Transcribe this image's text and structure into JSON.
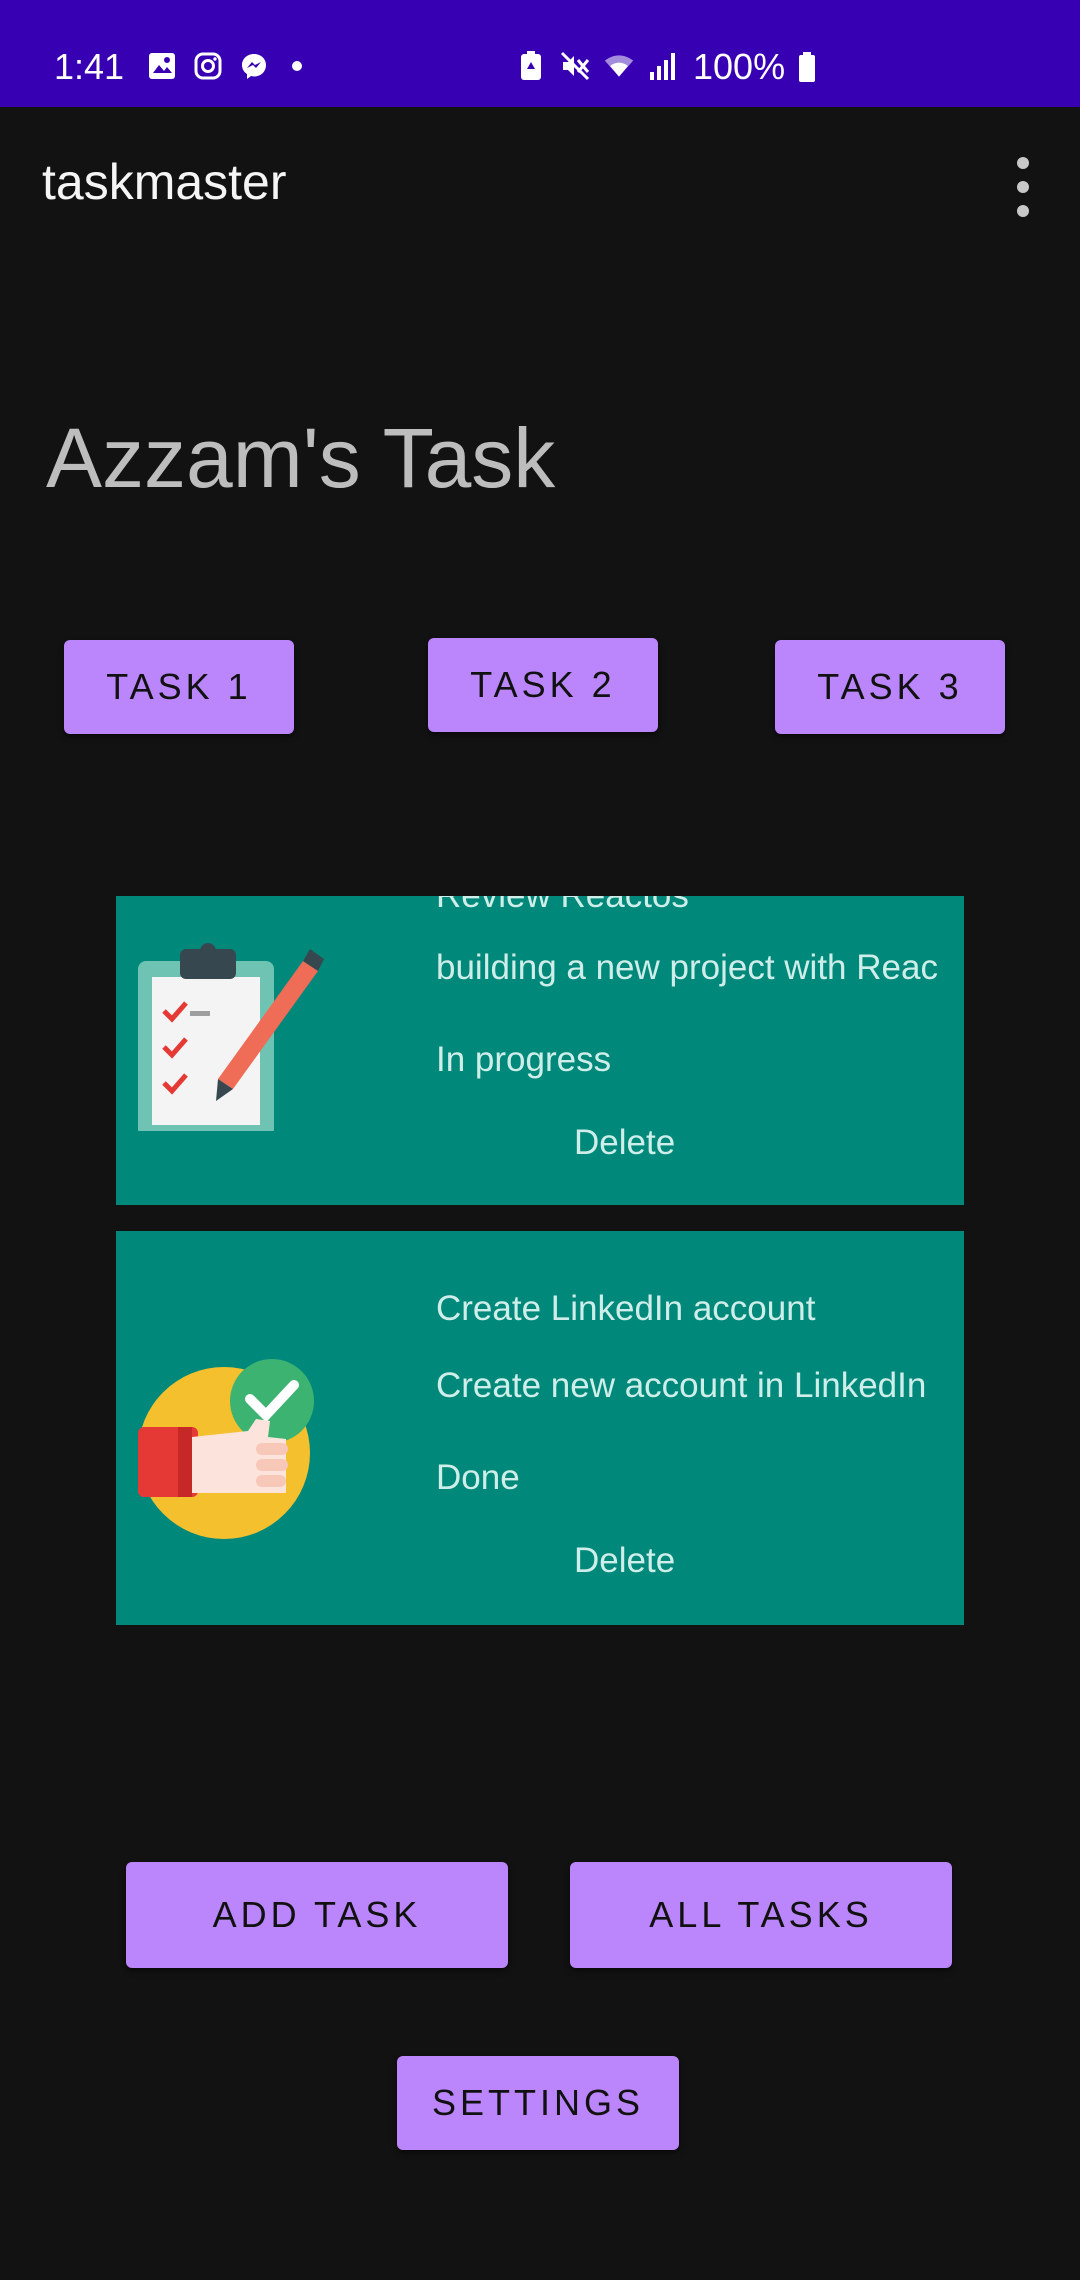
{
  "status_bar": {
    "time": "1:41",
    "battery": "100%",
    "left_icons": [
      "image-icon",
      "instagram-icon",
      "messenger-icon",
      "dot-icon"
    ],
    "right_icons": [
      "battery-saver-icon",
      "mute-icon",
      "wifi-icon",
      "signal-icon",
      "battery-icon"
    ]
  },
  "app_bar": {
    "title": "taskmaster",
    "menu_icon": "more-vert-icon"
  },
  "heading": "Azzam's Task",
  "task_buttons": [
    "TASK 1",
    "TASK 2",
    "TASK 3"
  ],
  "tasks": [
    {
      "title": "Review Reactos",
      "body": "building a new project with Reac",
      "state": "In progress",
      "delete_label": "Delete",
      "image": "clipboard-checklist-icon"
    },
    {
      "title": "Create LinkedIn account",
      "body": "Create new account in LinkedIn",
      "state": "Done",
      "delete_label": "Delete",
      "image": "thumbs-up-check-icon"
    }
  ],
  "bottom_buttons": {
    "add": "ADD TASK",
    "all": "ALL TASKS",
    "settings": "SETTINGS"
  },
  "colors": {
    "status_bar": "#3700b3",
    "background": "#121212",
    "button": "#bb86fc",
    "card": "#00897b"
  }
}
